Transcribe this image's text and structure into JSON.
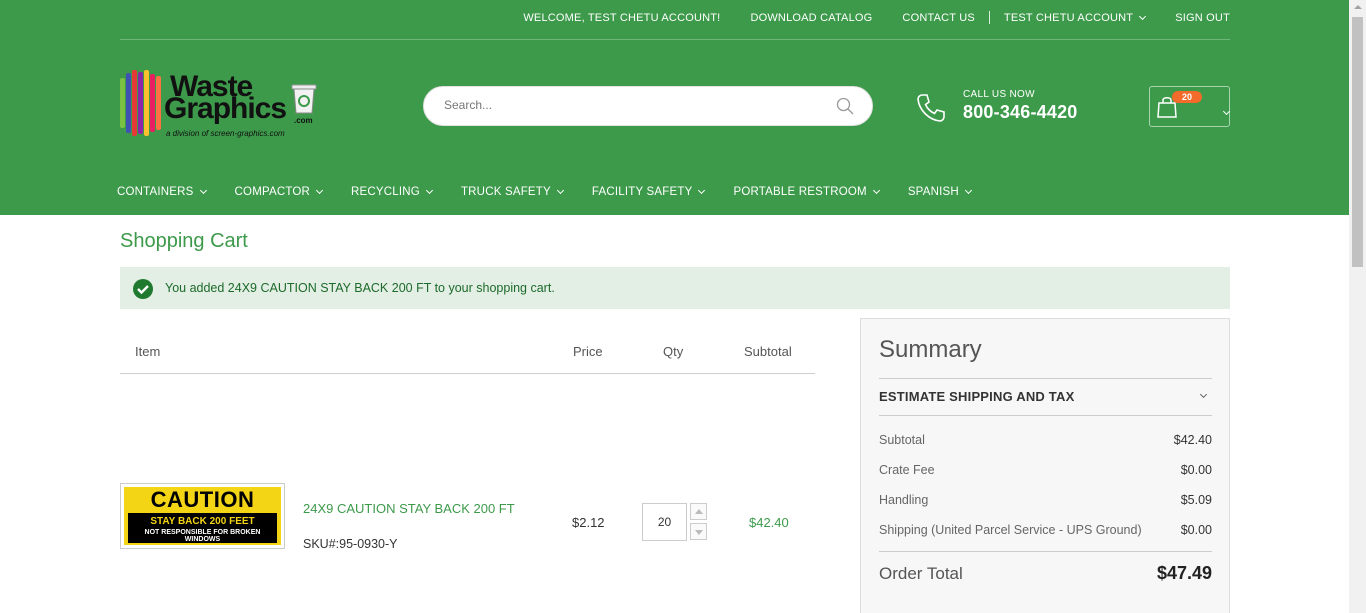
{
  "topbar": {
    "welcome": "WELCOME, TEST CHETU ACCOUNT!",
    "download_catalog": "DOWNLOAD CATALOG",
    "contact_us": "CONTACT US",
    "account": "TEST CHETU ACCOUNT",
    "sign_out": "SIGN OUT"
  },
  "logo": {
    "word1": "Waste",
    "word2": "Graphics",
    "suffix": ".com",
    "tagline": "a division of screen-graphics.com"
  },
  "search": {
    "placeholder": "Search..."
  },
  "contact": {
    "call_label": "CALL US NOW",
    "phone": "800-346-4420"
  },
  "cart": {
    "count": "20"
  },
  "nav": [
    "CONTAINERS",
    "COMPACTOR",
    "RECYCLING",
    "TRUCK SAFETY",
    "FACILITY SAFETY",
    "PORTABLE RESTROOM",
    "SPANISH"
  ],
  "page": {
    "title": "Shopping Cart",
    "message": "You added 24X9 CAUTION STAY BACK 200 FT to your shopping cart."
  },
  "table": {
    "headers": {
      "item": "Item",
      "price": "Price",
      "qty": "Qty",
      "subtotal": "Subtotal"
    },
    "row": {
      "image_text": {
        "caution": "CAUTION",
        "line1": "STAY BACK 200 FEET",
        "line2": "NOT RESPONSIBLE FOR BROKEN WINDOWS"
      },
      "name": "24X9 CAUTION STAY BACK 200 FT",
      "sku": "SKU#:95-0930-Y",
      "price": "$2.12",
      "qty": "20",
      "subtotal": "$42.40"
    }
  },
  "summary": {
    "title": "Summary",
    "estimate": "ESTIMATE SHIPPING AND TAX",
    "rows": [
      {
        "label": "Subtotal",
        "value": "$42.40"
      },
      {
        "label": "Crate Fee",
        "value": "$0.00"
      },
      {
        "label": "Handling",
        "value": "$5.09"
      },
      {
        "label": "Shipping (United Parcel Service - UPS Ground)",
        "value": "$0.00"
      }
    ],
    "order_total_label": "Order Total",
    "order_total": "$47.49"
  },
  "colors": {
    "brand_green": "#3d9a4b",
    "badge_orange": "#f26b2a",
    "message_bg": "#e3eee5"
  },
  "icons": [
    "search-icon",
    "phone-icon",
    "shopping-bag-icon",
    "check-circle-icon",
    "chevron-down-icon",
    "recycle-bin-icon"
  ]
}
